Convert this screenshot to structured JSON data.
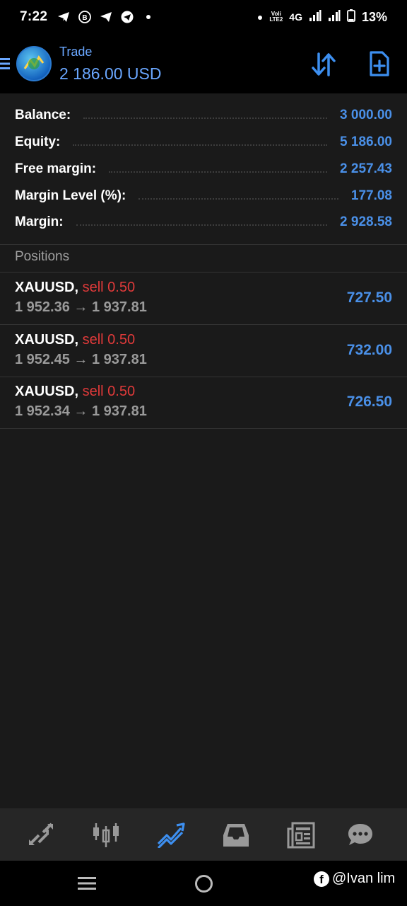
{
  "status_bar": {
    "time": "7:22",
    "network_top": "Voli",
    "network_bottom": "LTE2",
    "network_type": "4G",
    "battery": "13%"
  },
  "header": {
    "title": "Trade",
    "subtitle": "2 186.00 USD"
  },
  "summary": [
    {
      "label": "Balance:",
      "value": "3 000.00"
    },
    {
      "label": "Equity:",
      "value": "5 186.00"
    },
    {
      "label": "Free margin:",
      "value": "2 257.43"
    },
    {
      "label": "Margin Level (%):",
      "value": "177.08"
    },
    {
      "label": "Margin:",
      "value": "2 928.58"
    }
  ],
  "positions": {
    "title": "Positions",
    "items": [
      {
        "symbol": "XAUUSD,",
        "side": "sell 0.50",
        "prices": "1 952.36 → 1 937.81",
        "profit": "727.50"
      },
      {
        "symbol": "XAUUSD,",
        "side": "sell 0.50",
        "prices": "1 952.45 → 1 937.81",
        "profit": "732.00"
      },
      {
        "symbol": "XAUUSD,",
        "side": "sell 0.50",
        "prices": "1 952.34 → 1 937.81",
        "profit": "726.50"
      }
    ]
  },
  "bottom_nav": {
    "items": [
      {
        "icon": "quotes-icon",
        "active": false
      },
      {
        "icon": "chart-icon",
        "active": false
      },
      {
        "icon": "trade-icon",
        "active": true
      },
      {
        "icon": "history-icon",
        "active": false
      },
      {
        "icon": "news-icon",
        "active": false
      },
      {
        "icon": "messages-icon",
        "active": false
      }
    ]
  },
  "watermark": {
    "fb_letter": "f",
    "text": "@Ivan lim"
  },
  "colors": {
    "accent": "#4a90e8",
    "header_text": "#6aa7ff",
    "sell": "#e03a3a",
    "background": "#1a1a1a"
  }
}
